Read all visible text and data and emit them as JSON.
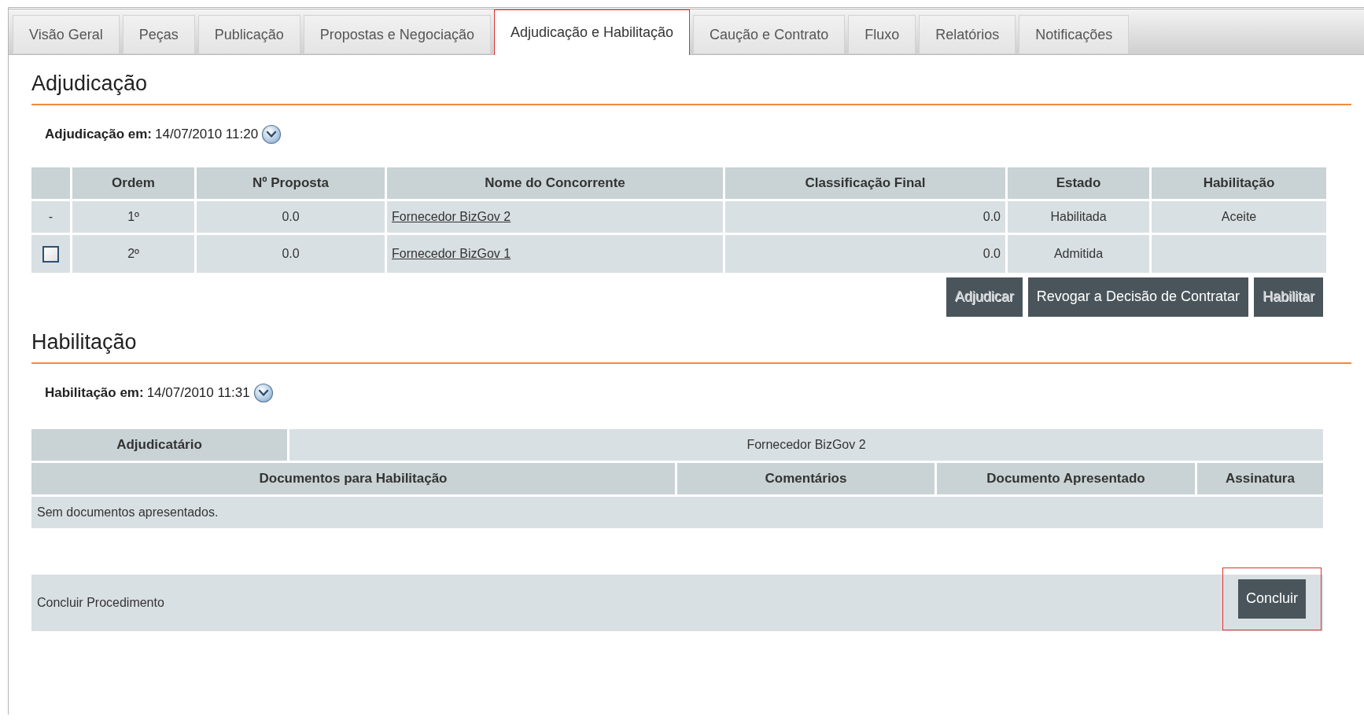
{
  "tabs": [
    {
      "label": "Visão Geral",
      "selected": false
    },
    {
      "label": "Peças",
      "selected": false
    },
    {
      "label": "Publicação",
      "selected": false
    },
    {
      "label": "Propostas e Negociação",
      "selected": false
    },
    {
      "label": "Adjudicação e Habilitação",
      "selected": true
    },
    {
      "label": "Caução e Contrato",
      "selected": false
    },
    {
      "label": "Fluxo",
      "selected": false
    },
    {
      "label": "Relatórios",
      "selected": false
    },
    {
      "label": "Notificações",
      "selected": false
    }
  ],
  "adjudicacao": {
    "title": "Adjudicação",
    "date_label": "Adjudicação em:",
    "date_value": "14/07/2010 11:20",
    "table": {
      "columns": [
        "",
        "Ordem",
        "Nº Proposta",
        "Nome do Concorrente",
        "Classificação Final",
        "Estado",
        "Habilitação"
      ],
      "rows": [
        {
          "select": {
            "kind": "text",
            "text": "-"
          },
          "ordem": "1º",
          "proposta": "0.0",
          "concorrente": "Fornecedor BizGov 2",
          "classificacao": "0.0",
          "estado": "Habilitada",
          "habilitacao": "Aceite"
        },
        {
          "select": {
            "kind": "checkbox",
            "checked": false
          },
          "ordem": "2º",
          "proposta": "0.0",
          "concorrente": "Fornecedor BizGov 1",
          "classificacao": "0.0",
          "estado": "Admitida",
          "habilitacao": ""
        }
      ]
    },
    "buttons": [
      {
        "label": "Adjudicar",
        "disabled": true
      },
      {
        "label": "Revogar a Decisão de Contratar",
        "disabled": false
      },
      {
        "label": "Habilitar",
        "disabled": true
      }
    ]
  },
  "habilitacao": {
    "title": "Habilitação",
    "date_label": "Habilitação em:",
    "date_value": "14/07/2010 11:31",
    "adjudicatario_label": "Adjudicatário",
    "adjudicatario_value": "Fornecedor BizGov 2",
    "documents_columns": [
      "Documentos para Habilitação",
      "Comentários",
      "Documento Apresentado",
      "Assinatura"
    ],
    "empty_message": "Sem documentos apresentados."
  },
  "conclude": {
    "label": "Concluir Procedimento",
    "button": "Concluir",
    "highlighted": true
  }
}
